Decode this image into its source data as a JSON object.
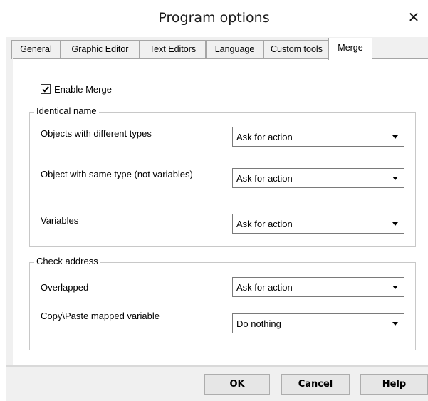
{
  "window": {
    "title": "Program options",
    "close_glyph": "✕",
    "close_icon": "close-icon"
  },
  "tabs": [
    {
      "label": "General",
      "active": false
    },
    {
      "label": "Graphic Editor",
      "active": false
    },
    {
      "label": "Text Editors",
      "active": false
    },
    {
      "label": "Language",
      "active": false
    },
    {
      "label": "Custom tools",
      "active": false
    },
    {
      "label": "Merge",
      "active": true
    }
  ],
  "merge": {
    "enable_label": "Enable Merge",
    "enable_checked": true,
    "identical_name": {
      "legend": "Identical name",
      "rows": [
        {
          "label": "Objects with different types",
          "value": "Ask for action"
        },
        {
          "label": "Object with same type (not variables)",
          "value": "Ask for action"
        },
        {
          "label": "Variables",
          "value": "Ask for action"
        }
      ]
    },
    "check_address": {
      "legend": "Check address",
      "rows": [
        {
          "label": "Overlapped",
          "value": "Ask for action"
        },
        {
          "label": "Copy\\Paste mapped variable",
          "value": "Do nothing"
        }
      ]
    }
  },
  "buttons": {
    "ok": "OK",
    "cancel": "Cancel",
    "help": "Help"
  },
  "colors": {
    "dialog_bg": "#f0f0f0",
    "panel_bg": "#ffffff",
    "border": "#a5a5a5"
  }
}
